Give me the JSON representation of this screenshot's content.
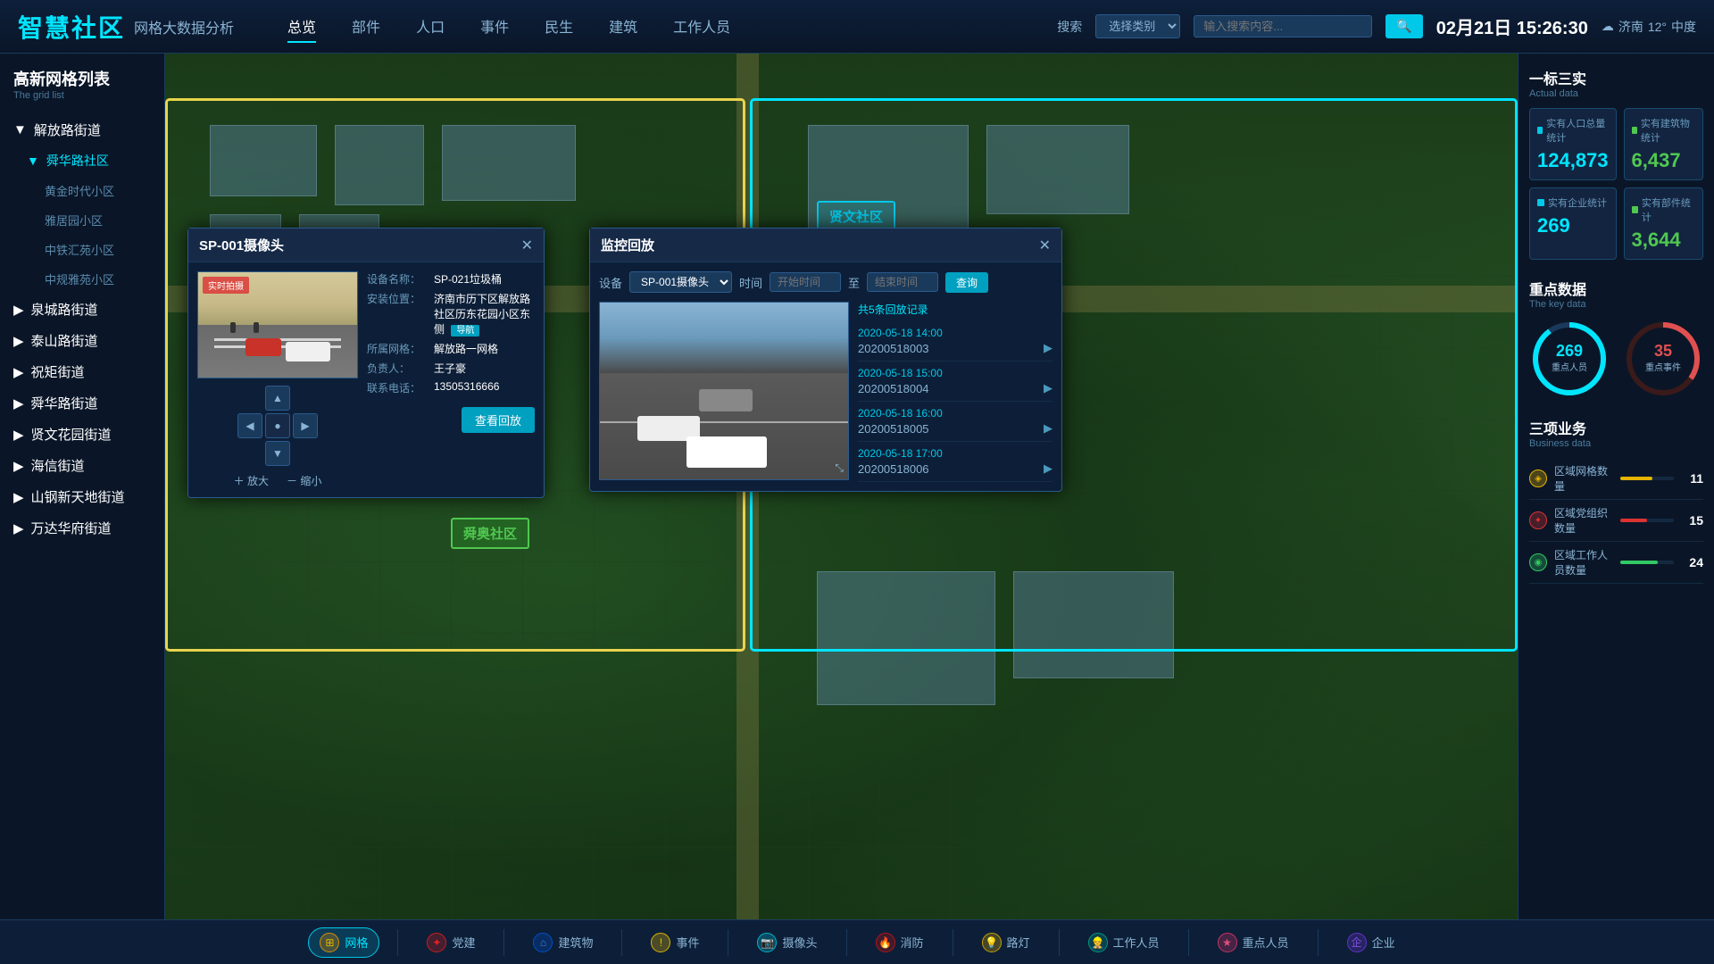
{
  "header": {
    "logo_cn": "智慧社区",
    "logo_subtitle": "网格大数据分析",
    "nav": [
      "总览",
      "部件",
      "人口",
      "事件",
      "民生",
      "建筑",
      "工作人员"
    ],
    "active_nav": "总览",
    "search_label": "搜索",
    "search_type": "选择类别",
    "search_placeholder": "输入搜索内容...",
    "datetime": "02月21日 15:26:30",
    "weather_city": "济南",
    "weather_temp": "12°",
    "weather_level": "中度"
  },
  "sidebar": {
    "title_cn": "高新网格列表",
    "title_en": "The grid list",
    "items": [
      {
        "label": "解放路街道",
        "level": "parent",
        "expanded": true
      },
      {
        "label": "舜华路社区",
        "level": "sub",
        "expanded": true,
        "active": true
      },
      {
        "label": "黄金时代小区",
        "level": "sub2"
      },
      {
        "label": "雅居园小区",
        "level": "sub2"
      },
      {
        "label": "中铁汇苑小区",
        "level": "sub2"
      },
      {
        "label": "中规雅苑小区",
        "level": "sub2"
      },
      {
        "label": "泉城路街道",
        "level": "parent"
      },
      {
        "label": "泰山路街道",
        "level": "parent"
      },
      {
        "label": "祝矩街道",
        "level": "parent"
      },
      {
        "label": "舜华路街道",
        "level": "parent"
      },
      {
        "label": "贤文花园街道",
        "level": "parent"
      },
      {
        "label": "海信街道",
        "level": "parent"
      },
      {
        "label": "山钢新天地街道",
        "level": "parent"
      },
      {
        "label": "万达华府街道",
        "level": "parent"
      }
    ]
  },
  "right_panel": {
    "section1": {
      "title_cn": "一标三实",
      "title_en": "Actual data",
      "stats": [
        {
          "label": "实有人口总量统计",
          "value": "124,873",
          "color": "cyan"
        },
        {
          "label": "实有建筑物统计",
          "value": "6,437",
          "color": "green"
        },
        {
          "label": "实有企业统计",
          "value": "269",
          "color": "cyan"
        },
        {
          "label": "实有部件统计",
          "value": "3,644",
          "color": "green"
        }
      ]
    },
    "section2": {
      "title_cn": "重点数据",
      "title_en": "The key data",
      "key_people": {
        "label": "重点人员",
        "value": 269,
        "max": 300,
        "color": "#00e5ff"
      },
      "key_events": {
        "label": "重点事件",
        "value": 35,
        "max": 100,
        "color": "#e05050"
      }
    },
    "section3": {
      "title_cn": "三项业务",
      "title_en": "Business data",
      "items": [
        {
          "label": "区域网格数量",
          "value": 11,
          "color": "yellow",
          "pct": 60
        },
        {
          "label": "区域党组织数量",
          "value": 15,
          "color": "red",
          "pct": 50
        },
        {
          "label": "区域工作人员数量",
          "value": 24,
          "color": "green",
          "pct": 70
        }
      ]
    }
  },
  "camera_popup": {
    "title": "SP-001摄像头",
    "feed_label": "实时拍摄",
    "info": {
      "device_name_label": "设备名称：",
      "device_name": "SP-021垃圾桶",
      "install_loc_label": "安装位置：",
      "install_loc": "济南市历下区解放路社区历东花园小区东侧",
      "install_badge": "导航",
      "grid_label": "所属网格：",
      "grid": "解放路一网格",
      "person_label": "负责人：",
      "person": "王子豪",
      "phone_label": "联系电话：",
      "phone": "13505316666"
    },
    "view_replay_btn": "查看回放"
  },
  "monitor_popup": {
    "title": "监控回放",
    "device_label": "设备",
    "device_value": "SP-001摄像头",
    "time_label": "时间",
    "start_placeholder": "开始时间",
    "end_placeholder": "结束时间",
    "query_btn": "查询",
    "record_count": "共5条回放记录",
    "records": [
      {
        "time": "2020-05-18  14:00",
        "id": "20200518003"
      },
      {
        "time": "2020-05-18  15:00",
        "id": "20200518004"
      },
      {
        "time": "2020-05-18  16:00",
        "id": "20200518005"
      },
      {
        "time": "2020-05-18  17:00",
        "id": "20200518006"
      }
    ]
  },
  "map": {
    "zones": [
      {
        "label": "贤文社区",
        "type": "cyan"
      },
      {
        "label": "舜奥社区",
        "type": "green"
      }
    ]
  },
  "bottom_bar": {
    "tools": [
      {
        "label": "网格",
        "icon": "grid-icon",
        "style": "orange",
        "active": true
      },
      {
        "label": "党建",
        "icon": "party-icon",
        "style": "red"
      },
      {
        "label": "建筑物",
        "icon": "building-icon",
        "style": "blue"
      },
      {
        "label": "事件",
        "icon": "event-icon",
        "style": "yellow-exc"
      },
      {
        "label": "摄像头",
        "icon": "camera-icon",
        "style": "cyan"
      },
      {
        "label": "消防",
        "icon": "fire-icon",
        "style": "darkred"
      },
      {
        "label": "路灯",
        "icon": "light-icon",
        "style": "amber"
      },
      {
        "label": "工作人员",
        "icon": "worker-icon",
        "style": "teal"
      },
      {
        "label": "重点人员",
        "icon": "key-person-icon",
        "style": "pink"
      },
      {
        "label": "企业",
        "icon": "enterprise-icon",
        "style": "purple"
      }
    ]
  }
}
